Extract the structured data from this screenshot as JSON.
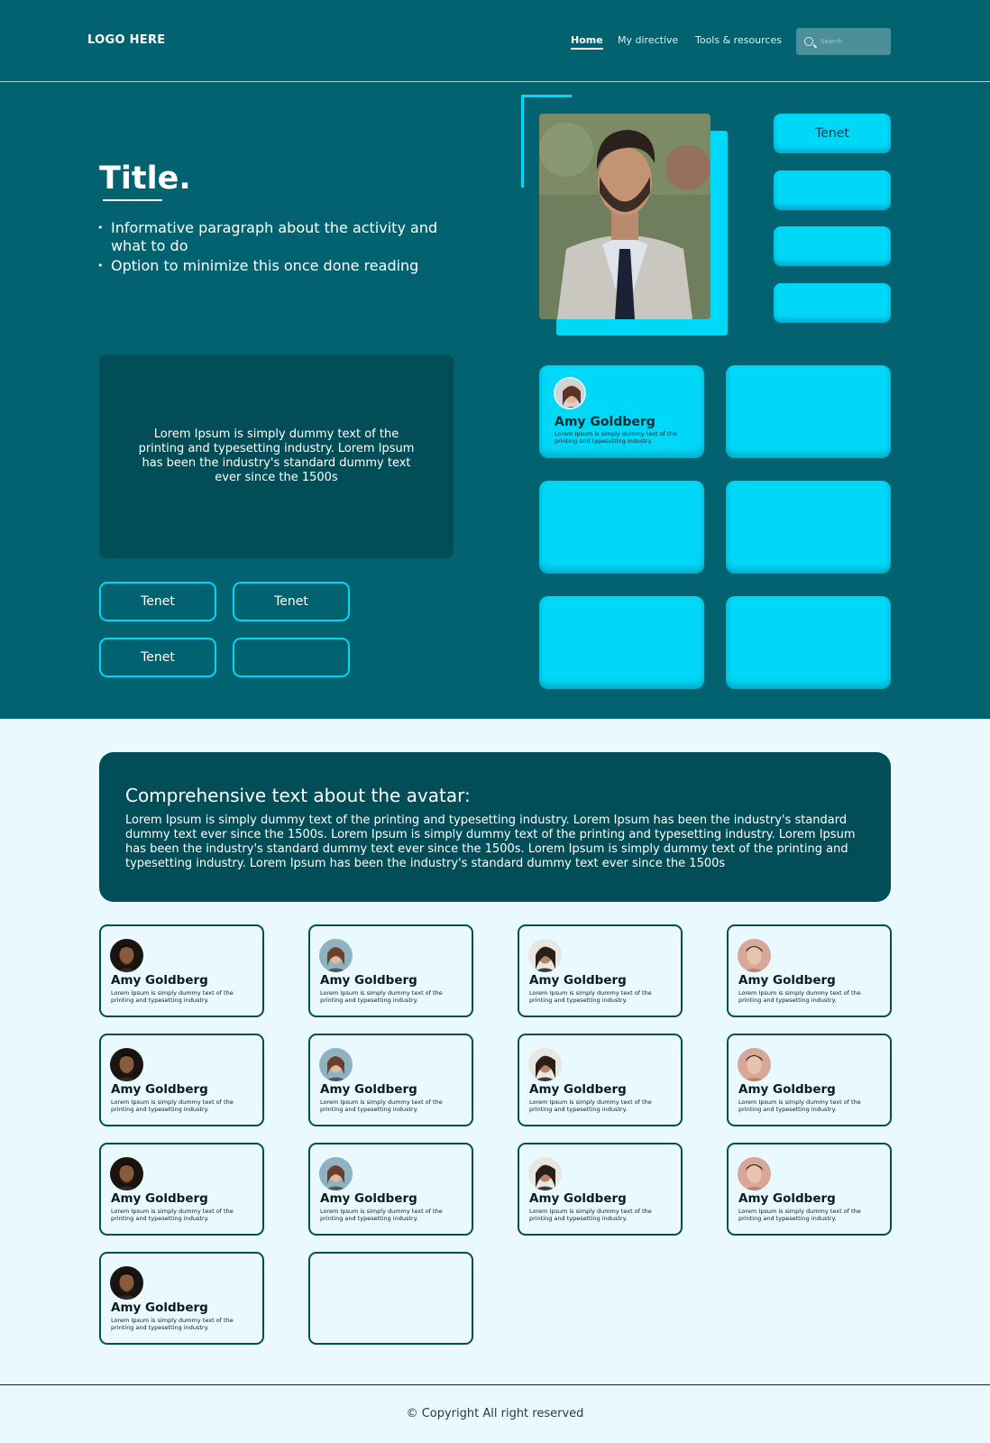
{
  "header": {
    "logo": "LOGO HERE",
    "nav": [
      {
        "label": "Home",
        "active": true
      },
      {
        "label": "My directive",
        "active": false
      },
      {
        "label": "Tools & resources",
        "active": false
      }
    ],
    "search_placeholder": "Search"
  },
  "hero": {
    "title": "Title.",
    "bullets": [
      "Informative paragraph about the activity and what to do",
      "Option to minimize this once done reading"
    ],
    "box_text": "Lorem Ipsum is simply dummy text of the printing and typesetting industry. Lorem Ipsum has been the industry's standard dummy text ever since the 1500s",
    "outline_buttons": [
      "Tenet",
      "Tenet",
      "Tenet",
      ""
    ],
    "side_buttons": [
      "Tenet",
      "",
      "",
      ""
    ],
    "featured_tile": {
      "name": "Amy Goldberg",
      "desc": "Lorem Ipsum is simply dummy text of the printing and typesetting industry."
    }
  },
  "about": {
    "heading": "Comprehensive text about the avatar:",
    "body": "Lorem Ipsum is simply dummy text of the printing and typesetting industry. Lorem Ipsum has been the industry's standard dummy text ever since the 1500s. Lorem Ipsum is simply dummy text of the printing and typesetting industry. Lorem Ipsum has been the industry's standard dummy text ever since the 1500s. Lorem Ipsum is simply dummy text of the printing and typesetting industry. Lorem Ipsum has been the industry's standard dummy text ever since the 1500s"
  },
  "cards": [
    {
      "name": "Amy Goldberg",
      "desc": "Lorem Ipsum is simply dummy text of the printing and typesetting industry."
    },
    {
      "name": "Amy Goldberg",
      "desc": "Lorem Ipsum is simply dummy text of the printing and typesetting industry."
    },
    {
      "name": "Amy Goldberg",
      "desc": "Lorem Ipsum is simply dummy text of the printing and typesetting industry."
    },
    {
      "name": "Amy Goldberg",
      "desc": "Lorem Ipsum is simply dummy text of the printing and typesetting industry."
    },
    {
      "name": "Amy Goldberg",
      "desc": "Lorem Ipsum is simply dummy text of the printing and typesetting industry."
    },
    {
      "name": "Amy Goldberg",
      "desc": "Lorem Ipsum is simply dummy text of the printing and typesetting industry."
    },
    {
      "name": "Amy Goldberg",
      "desc": "Lorem Ipsum is simply dummy text of the printing and typesetting industry."
    },
    {
      "name": "Amy Goldberg",
      "desc": "Lorem Ipsum is simply dummy text of the printing and typesetting industry."
    },
    {
      "name": "Amy Goldberg",
      "desc": "Lorem Ipsum is simply dummy text of the printing and typesetting industry."
    },
    {
      "name": "Amy Goldberg",
      "desc": "Lorem Ipsum is simply dummy text of the printing and typesetting industry."
    },
    {
      "name": "Amy Goldberg",
      "desc": "Lorem Ipsum is simply dummy text of the printing and typesetting industry."
    },
    {
      "name": "Amy Goldberg",
      "desc": "Lorem Ipsum is simply dummy text of the printing and typesetting industry."
    },
    {
      "name": "Amy Goldberg",
      "desc": "Lorem Ipsum is simply dummy text of the printing and typesetting industry."
    }
  ],
  "footer": {
    "copyright": "© Copyright All right reserved"
  },
  "colors": {
    "brand_dark": "#02626f",
    "panel_dark": "#014e59",
    "accent_cyan": "#00d8f8",
    "page_bg": "#e9f9fe"
  }
}
